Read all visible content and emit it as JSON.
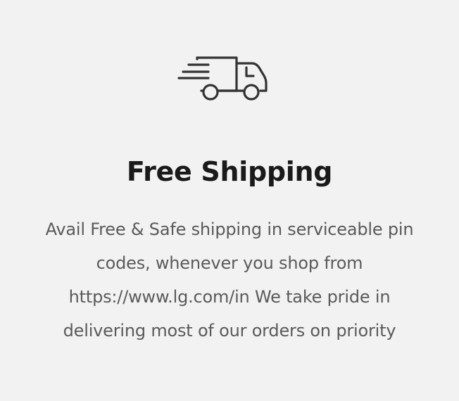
{
  "feature": {
    "icon": "delivery-truck-icon",
    "title": "Free Shipping",
    "description_lines": [
      "Avail Free & Safe shipping in serviceable pin",
      "codes, whenever you shop from",
      "https://www.lg.com/in We take pride in",
      "delivering most of our orders on priority"
    ],
    "colors": {
      "background": "#f2f2f2",
      "title": "#1a1a1a",
      "description": "#5a5a5a",
      "icon_stroke": "#333333"
    }
  }
}
